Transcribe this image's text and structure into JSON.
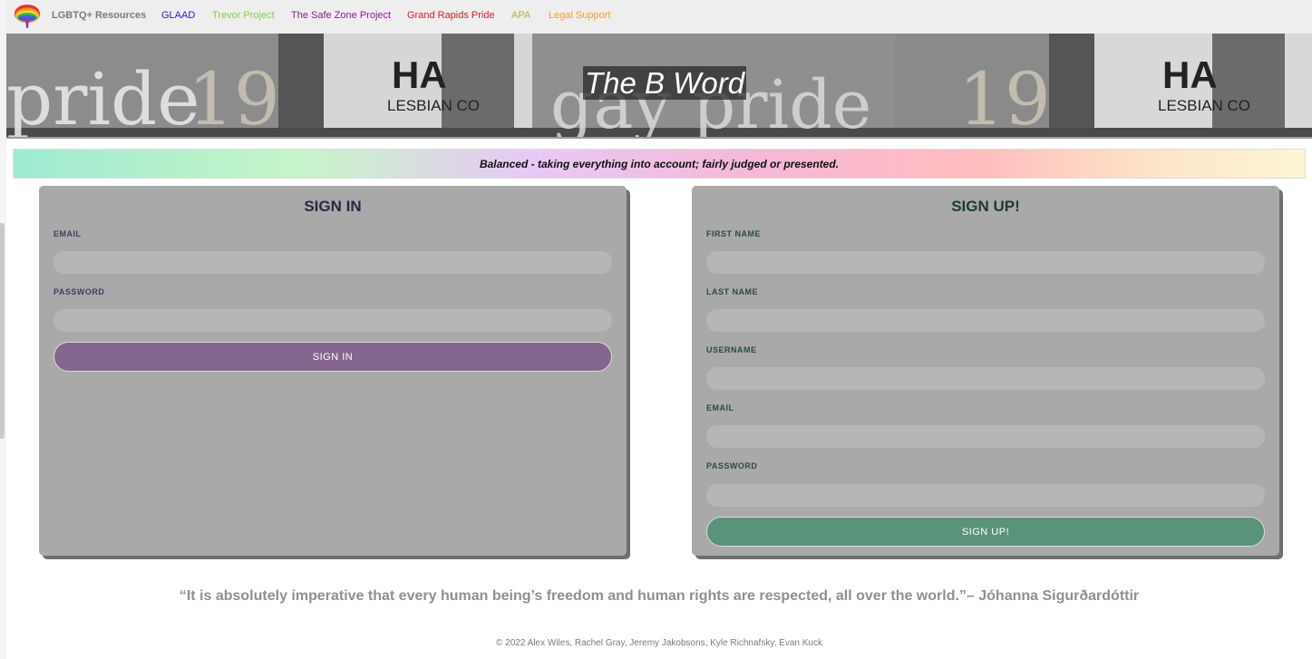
{
  "navbar": {
    "brand": "LGBTQ+ Resources",
    "links": [
      {
        "label": "GLAAD",
        "color": "#2020d0"
      },
      {
        "label": "Trevor Project",
        "color": "#86c94e"
      },
      {
        "label": "The Safe Zone Project",
        "color": "#8a1d95"
      },
      {
        "label": "Grand Rapids Pride",
        "color": "#e0142a"
      },
      {
        "label": "APA",
        "color": "#b7b23c"
      },
      {
        "label": "Legal Support",
        "color": "#f0a020"
      }
    ],
    "logo_icon": "rainbow-brain-icon"
  },
  "hero": {
    "title": "The B Word",
    "banner_texts": [
      "pride",
      "19",
      "HA",
      "LESBIAN CO",
      "gay pride",
      "19",
      "HA",
      "LESBIAN CO"
    ]
  },
  "tagline": "Balanced - taking everything into account; fairly judged or presented.",
  "signin": {
    "title": "SIGN IN",
    "email_label": "EMAIL",
    "password_label": "PASSWORD",
    "button_label": "SIGN IN"
  },
  "signup": {
    "title": "SIGN UP!",
    "first_name_label": "FIRST NAME",
    "last_name_label": "LAST NAME",
    "username_label": "USERNAME",
    "email_label": "EMAIL",
    "password_label": "PASSWORD",
    "button_label": "SIGN UP!"
  },
  "quote": "“It is absolutely imperative that every human being’s freedom and human rights are respected, all over the world.”– Jóhanna Sigurðardóttir",
  "footer": "© 2022 Alex Wiles, Rachel Gray, Jeremy Jakobsons, Kyle Richnafsky, Evan Kuck",
  "colors": {
    "signin_accent": "#84668e",
    "signup_accent": "#5b927a",
    "card_bg": "#a9a9a9"
  }
}
